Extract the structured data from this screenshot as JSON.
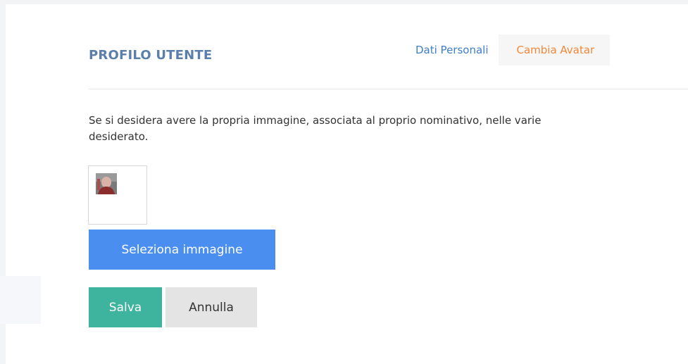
{
  "page": {
    "title": "PROFILO UTENTE"
  },
  "tabs": [
    {
      "label": "Dati Personali",
      "active": false
    },
    {
      "label": "Cambia Avatar",
      "active": true
    }
  ],
  "content": {
    "description_line_1": "Se si desidera avere la propria immagine, associata al proprio nominativo, nelle varie",
    "description_line_2": "desiderato."
  },
  "avatar": {
    "alt": "avatar utente"
  },
  "buttons": {
    "select_image": "Seleziona immagine",
    "save": "Salva",
    "cancel": "Annulla"
  },
  "colors": {
    "title": "#5b7fab",
    "tab_link": "#3f7ec8",
    "tab_active": "#f0883a",
    "select_button": "#4a8ff0",
    "save_button": "#3eb49e",
    "cancel_button": "#e4e4e4"
  }
}
